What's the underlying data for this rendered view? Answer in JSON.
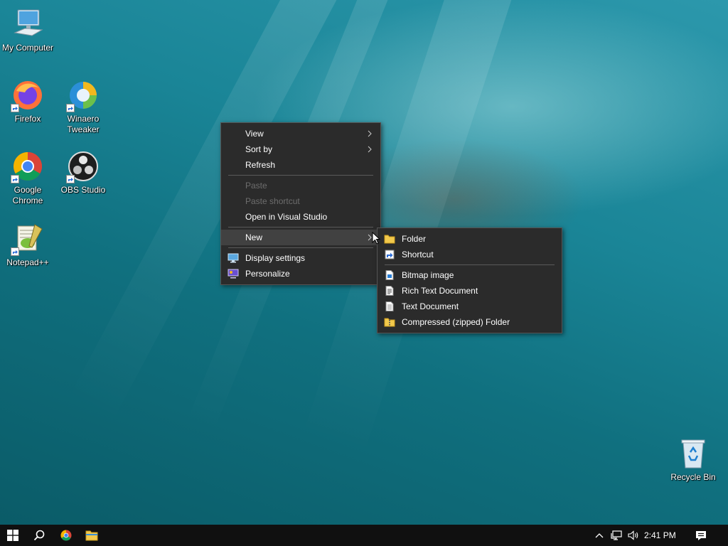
{
  "desktop": {
    "icons": [
      {
        "label": "My Computer",
        "icon": "computer-icon"
      },
      {
        "label": "Firefox",
        "icon": "firefox-icon"
      },
      {
        "label": "Winaero Tweaker",
        "icon": "winaero-tweaker-icon"
      },
      {
        "label": "Google Chrome",
        "icon": "chrome-icon"
      },
      {
        "label": "OBS Studio",
        "icon": "obs-icon"
      },
      {
        "label": "Notepad++",
        "icon": "notepadpp-icon"
      },
      {
        "label": "Recycle Bin",
        "icon": "recycle-bin-icon"
      }
    ]
  },
  "context_menu": {
    "view": "View",
    "sort_by": "Sort by",
    "refresh": "Refresh",
    "paste": "Paste",
    "paste_shortcut": "Paste shortcut",
    "open_vs": "Open in Visual Studio",
    "new": "New",
    "display_settings": "Display settings",
    "personalize": "Personalize"
  },
  "new_submenu": {
    "folder": "Folder",
    "shortcut": "Shortcut",
    "bitmap": "Bitmap image",
    "rtf": "Rich Text Document",
    "text": "Text Document",
    "zip": "Compressed (zipped) Folder"
  },
  "taskbar": {
    "clock": "2:41 PM",
    "pinned": [
      "start-icon",
      "search-icon",
      "chrome-icon",
      "file-explorer-icon"
    ],
    "tray": [
      "chevron-up-icon",
      "network-icon",
      "volume-icon",
      "notifications-icon"
    ]
  },
  "colors": {
    "menu_bg": "#2b2b2b",
    "menu_hover": "#414141",
    "taskbar_bg": "#101010",
    "start_blue": "#ffffff"
  }
}
